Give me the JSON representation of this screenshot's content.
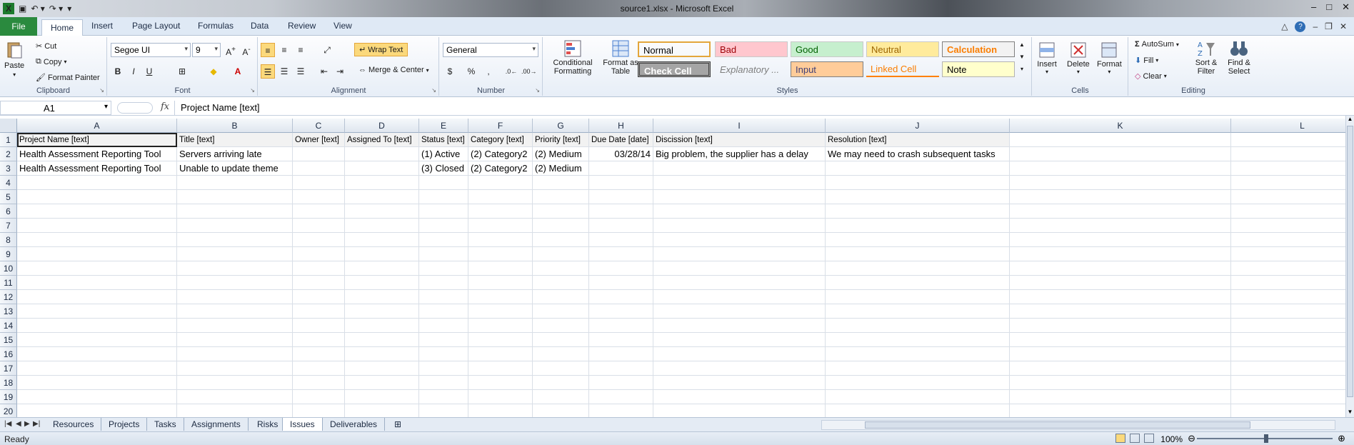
{
  "window": {
    "title": "source1.xlsx - Microsoft Excel"
  },
  "qat": {
    "logo": "X"
  },
  "tabs": [
    "File",
    "Home",
    "Insert",
    "Page Layout",
    "Formulas",
    "Data",
    "Review",
    "View"
  ],
  "clipboard": {
    "paste": "Paste",
    "cut": "Cut",
    "copy": "Copy",
    "format_painter": "Format Painter",
    "label": "Clipboard"
  },
  "font": {
    "name": "Segoe UI",
    "size": "9",
    "bold": "B",
    "italic": "I",
    "underline": "U",
    "label": "Font"
  },
  "alignment": {
    "wrap": "Wrap Text",
    "merge": "Merge & Center",
    "label": "Alignment"
  },
  "number": {
    "format": "General",
    "percent": "%",
    "comma": ",",
    "label": "Number"
  },
  "styles": {
    "conditional": "Conditional Formatting",
    "format_table": "Format as Table",
    "items": [
      {
        "name": "Normal",
        "bg": "#ffffff",
        "fg": "#000000"
      },
      {
        "name": "Bad",
        "bg": "#ffc7ce",
        "fg": "#9c0006"
      },
      {
        "name": "Good",
        "bg": "#c6efce",
        "fg": "#006100"
      },
      {
        "name": "Neutral",
        "bg": "#ffeb9c",
        "fg": "#9c6500"
      },
      {
        "name": "Calculation",
        "bg": "#f2f2f2",
        "fg": "#fa7d00"
      },
      {
        "name": "Check Cell",
        "bg": "#a5a5a5",
        "fg": "#ffffff"
      },
      {
        "name": "Explanatory ...",
        "bg": "#ffffff",
        "fg": "#7f7f7f"
      },
      {
        "name": "Input",
        "bg": "#ffcc99",
        "fg": "#3f3f76"
      },
      {
        "name": "Linked Cell",
        "bg": "#ffffff",
        "fg": "#fa7d00"
      },
      {
        "name": "Note",
        "bg": "#ffffcc",
        "fg": "#000000"
      }
    ],
    "label": "Styles"
  },
  "cells_group": {
    "insert": "Insert",
    "delete": "Delete",
    "format": "Format",
    "label": "Cells"
  },
  "editing": {
    "autosum": "AutoSum",
    "fill": "Fill",
    "clear": "Clear",
    "sort": "Sort & Filter",
    "find": "Find & Select",
    "label": "Editing"
  },
  "formula_bar": {
    "cell_ref": "A1",
    "fx": "fx",
    "formula": "Project Name [text]"
  },
  "columns": [
    "A",
    "B",
    "C",
    "D",
    "E",
    "F",
    "G",
    "H",
    "I",
    "J",
    "K",
    "L"
  ],
  "rows": [
    "1",
    "2",
    "3",
    "4",
    "5",
    "6",
    "7",
    "8",
    "9",
    "10",
    "11",
    "12",
    "13",
    "14",
    "15",
    "16",
    "17",
    "18",
    "19",
    "20"
  ],
  "sheet": {
    "header": [
      "Project Name [text]",
      "Title [text]",
      "Owner [text]",
      "Assigned To [text]",
      "Status [text]",
      "Category [text]",
      "Priority [text]",
      "Due Date [date]",
      "Discission [text]",
      "Resolution [text]"
    ],
    "data": [
      [
        "Health Assessment Reporting Tool",
        "Servers arriving late",
        "",
        "",
        "(1) Active",
        "(2) Category2",
        "(2) Medium",
        "03/28/14",
        "Big problem, the supplier has a delay",
        "We may need to crash subsequent tasks"
      ],
      [
        "Health Assessment Reporting Tool",
        "Unable to update theme",
        "",
        "",
        "(3) Closed",
        "(2) Category2",
        "(2) Medium",
        "",
        "",
        ""
      ]
    ]
  },
  "sheet_tabs": [
    "Resources",
    "Projects",
    "Tasks",
    "Assignments",
    "Risks",
    "Issues",
    "Deliverables"
  ],
  "active_sheet": "Issues",
  "status": {
    "text": "Ready",
    "zoom": "100%"
  }
}
